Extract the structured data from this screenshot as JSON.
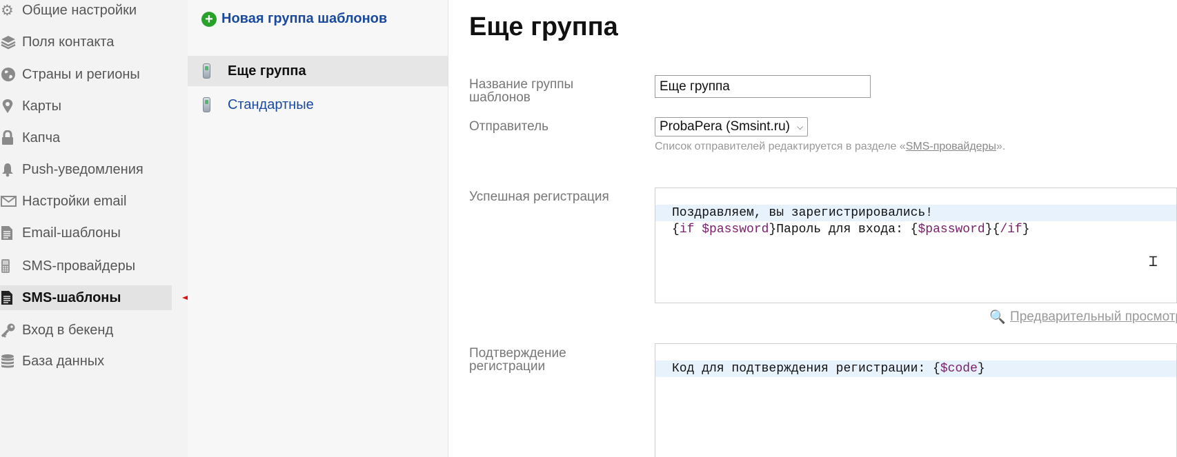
{
  "sidebar": {
    "items": [
      {
        "label": "Общие настройки",
        "icon": "gear-icon"
      },
      {
        "label": "Поля контакта",
        "icon": "layers-icon"
      },
      {
        "label": "Страны и регионы",
        "icon": "globe-icon"
      },
      {
        "label": "Карты",
        "icon": "map-pin-icon"
      },
      {
        "label": "Капча",
        "icon": "lock-icon"
      },
      {
        "label": "Push-уведомления",
        "icon": "bell-icon"
      },
      {
        "label": "Настройки email",
        "icon": "envelope-icon"
      },
      {
        "label": "Email-шаблоны",
        "icon": "document-icon"
      },
      {
        "label": "SMS-провайдеры",
        "icon": "phone-icon"
      },
      {
        "label": "SMS-шаблоны",
        "icon": "document-icon",
        "active": true
      },
      {
        "label": "Вход в бекенд",
        "icon": "key-icon"
      },
      {
        "label": "База данных",
        "icon": "database-icon"
      }
    ]
  },
  "groups": {
    "new_group_label": "Новая группа шаблонов",
    "items": [
      {
        "label": "Еще группа",
        "active": true
      },
      {
        "label": "Стандартные",
        "active": false
      }
    ]
  },
  "main": {
    "title": "Еще группа",
    "group_name_label": "Название группы шаблонов",
    "group_name_value": "Еще группа",
    "sender_label": "Отправитель",
    "sender_value": "ProbaPera (Smsint.ru)",
    "sender_hint_prefix": "Список отправителей редактируется в разделе «",
    "sender_hint_link": "SMS-провайдеры",
    "sender_hint_suffix": "».",
    "success_label": "Успешная регистрация",
    "success_line1": "Поздравляем, вы зарегистрировались!",
    "success_line2": {
      "p1": "{",
      "p2": "if $password",
      "p3": "}Пароль для входа: {",
      "p4": "$password",
      "p5": "}{",
      "p6": "/if",
      "p7": "}"
    },
    "preview_label": "Предварительный просмотр",
    "confirm_label": "Подтверждение регистрации",
    "confirm_line1": {
      "p1": "Код для подтверждения регистрации: {",
      "p2": "$code",
      "p3": "}"
    }
  },
  "colors": {
    "accent_link": "#1a4aa0",
    "arrow": "#e01010",
    "add_green": "#2aa12a",
    "code_keyword": "#7a1e6b"
  }
}
